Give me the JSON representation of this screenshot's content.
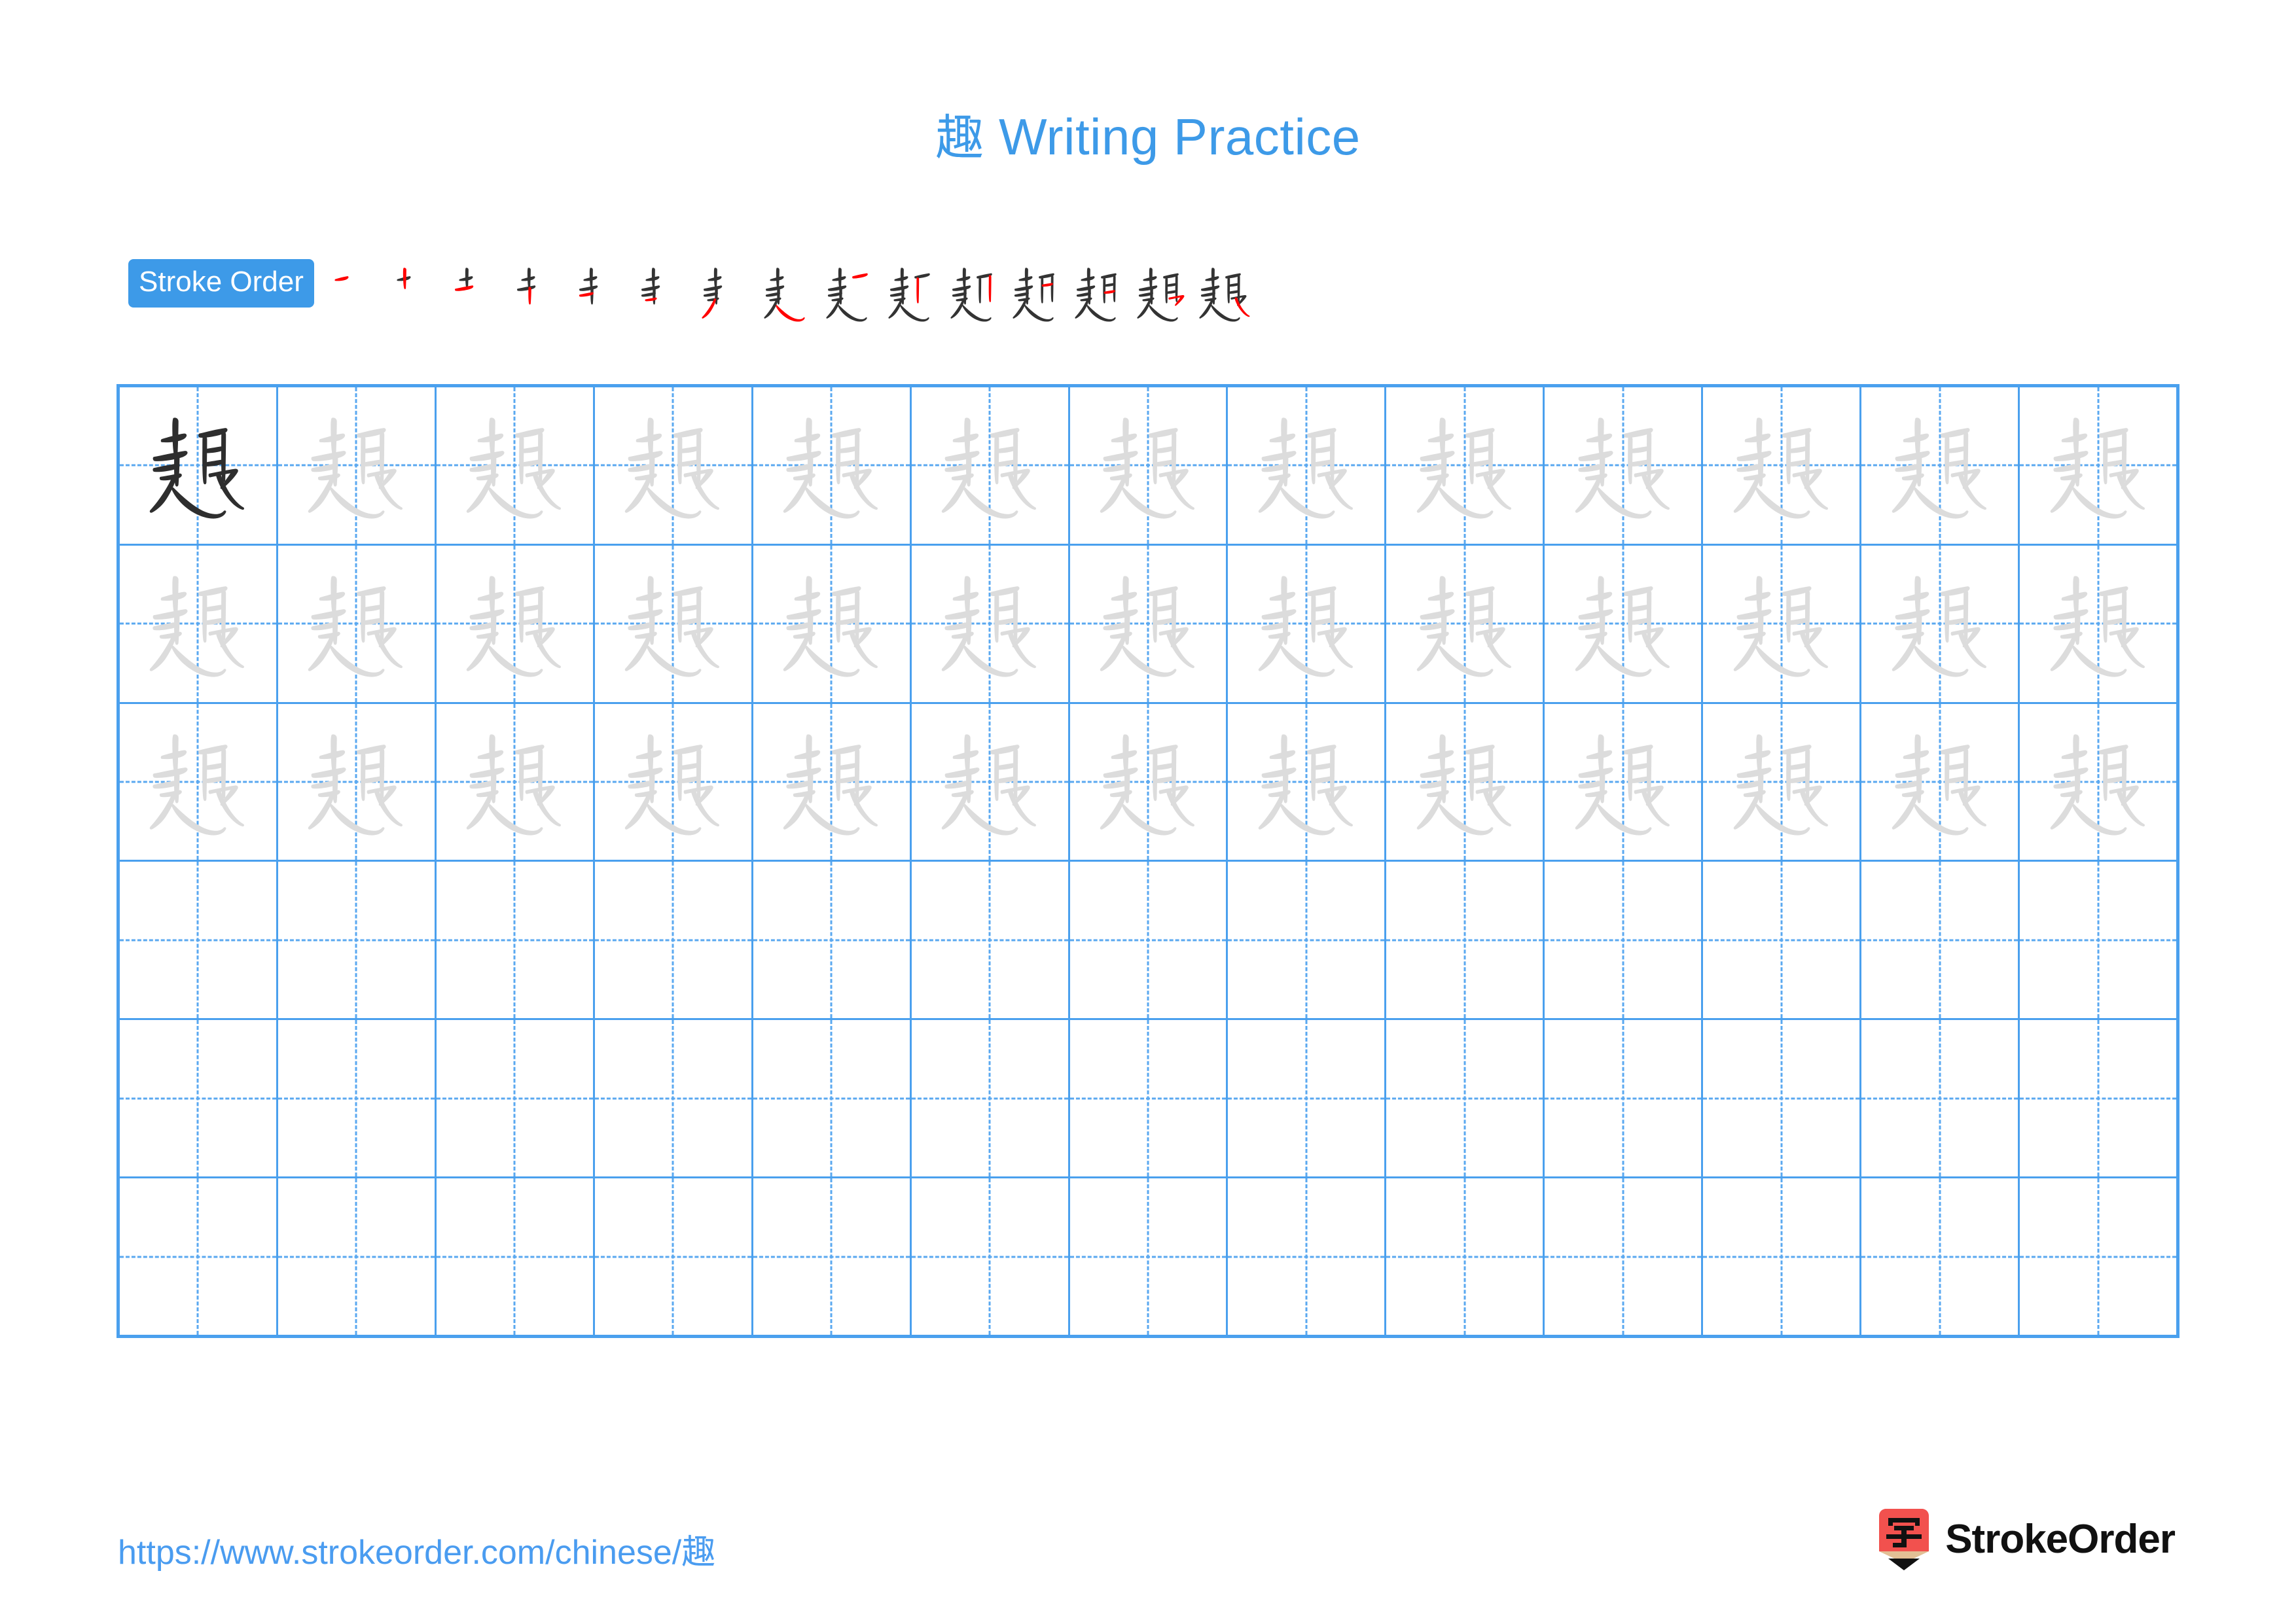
{
  "character": "趣",
  "title": {
    "character": "趣",
    "suffix": " Writing Practice",
    "full": "趣 Writing Practice",
    "color": "#3d9ae8"
  },
  "stroke_order": {
    "label": "Stroke Order",
    "badge_bg": "#3d9ae8",
    "badge_text_color": "#ffffff",
    "total_strokes": 15,
    "new_stroke_color": "#ff0000",
    "existing_stroke_color": "#333333",
    "steps": [
      {
        "index": 1,
        "glyph": "一",
        "new_stroke": "horizontal"
      },
      {
        "index": 2,
        "glyph": "十",
        "new_stroke": "vertical"
      },
      {
        "index": 3,
        "glyph": "土",
        "new_stroke": "horizontal"
      },
      {
        "index": 4,
        "glyph": "圭",
        "new_stroke": "vertical"
      },
      {
        "index": 5,
        "glyph": "耂",
        "new_stroke": "horizontal"
      },
      {
        "index": 6,
        "glyph": "龶",
        "new_stroke": "horizontal"
      },
      {
        "index": 7,
        "glyph": "丰",
        "new_stroke": "left-falling"
      },
      {
        "index": 8,
        "glyph": "走",
        "new_stroke": "horizontal-sweep"
      },
      {
        "index": 9,
        "glyph": "走",
        "new_stroke": "short-horizontal"
      },
      {
        "index": 10,
        "glyph": "赸",
        "new_stroke": "vertical"
      },
      {
        "index": 11,
        "glyph": "赿",
        "new_stroke": "vertical"
      },
      {
        "index": 12,
        "glyph": "趄",
        "new_stroke": "short-horizontal"
      },
      {
        "index": 13,
        "glyph": "趄",
        "new_stroke": "short-horizontal"
      },
      {
        "index": 14,
        "glyph": "趣",
        "new_stroke": "horizontal-hook"
      },
      {
        "index": 15,
        "glyph": "趣",
        "new_stroke": "right-falling"
      }
    ]
  },
  "grid": {
    "columns": 13,
    "rows": 6,
    "border_color": "#4aa0ee",
    "guide_color": "#5aa8f0",
    "traced_rows": 3,
    "blank_rows": 3,
    "model_char_color": "#2e2e2e",
    "trace_char_color": "#dcdcdc",
    "cells": [
      [
        "model",
        "trace",
        "trace",
        "trace",
        "trace",
        "trace",
        "trace",
        "trace",
        "trace",
        "trace",
        "trace",
        "trace",
        "trace"
      ],
      [
        "trace",
        "trace",
        "trace",
        "trace",
        "trace",
        "trace",
        "trace",
        "trace",
        "trace",
        "trace",
        "trace",
        "trace",
        "trace"
      ],
      [
        "trace",
        "trace",
        "trace",
        "trace",
        "trace",
        "trace",
        "trace",
        "trace",
        "trace",
        "trace",
        "trace",
        "trace",
        "trace"
      ],
      [
        "blank",
        "blank",
        "blank",
        "blank",
        "blank",
        "blank",
        "blank",
        "blank",
        "blank",
        "blank",
        "blank",
        "blank",
        "blank"
      ],
      [
        "blank",
        "blank",
        "blank",
        "blank",
        "blank",
        "blank",
        "blank",
        "blank",
        "blank",
        "blank",
        "blank",
        "blank",
        "blank"
      ],
      [
        "blank",
        "blank",
        "blank",
        "blank",
        "blank",
        "blank",
        "blank",
        "blank",
        "blank",
        "blank",
        "blank",
        "blank",
        "blank"
      ]
    ]
  },
  "footer": {
    "url": "https://www.strokeorder.com/chinese/趣",
    "url_color": "#4a9cf0",
    "brand_name": "StrokeOrder",
    "logo_character": "字",
    "logo_colors": {
      "body": "#f2514e",
      "wood": "#e2bf95",
      "tip": "#111111"
    }
  }
}
